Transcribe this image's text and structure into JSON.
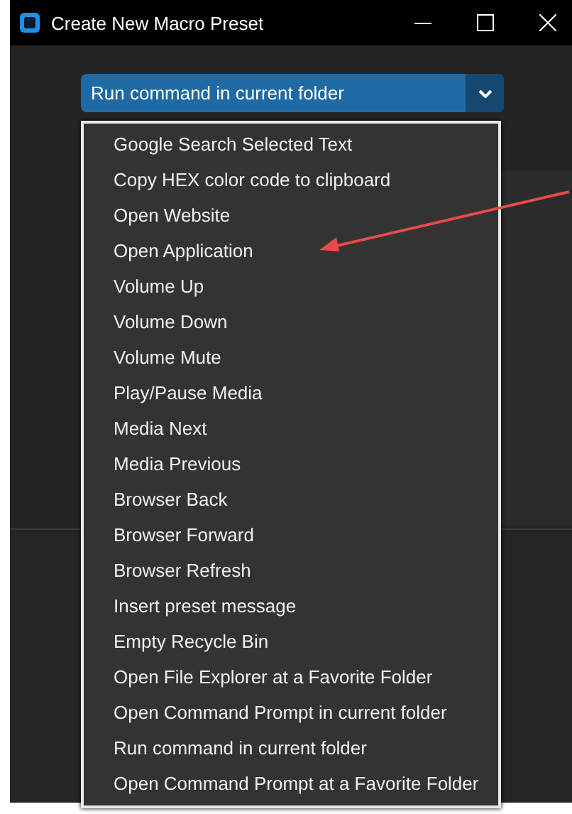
{
  "window": {
    "title": "Create New Macro Preset"
  },
  "dropdown": {
    "value": "Run command in current folder",
    "expanded": true,
    "options": [
      "Google Search Selected Text",
      "Copy HEX color code to clipboard",
      "Open Website",
      "Open Application",
      "Volume Up",
      "Volume Down",
      "Volume Mute",
      "Play/Pause Media",
      "Media Next",
      "Media Previous",
      "Browser Back",
      "Browser Forward",
      "Browser Refresh",
      "Insert preset message",
      "Empty Recycle Bin",
      "Open File Explorer at a Favorite Folder",
      "Open Command Prompt in current folder",
      "Run command in current folder",
      "Open Command Prompt at a Favorite Folder"
    ]
  }
}
